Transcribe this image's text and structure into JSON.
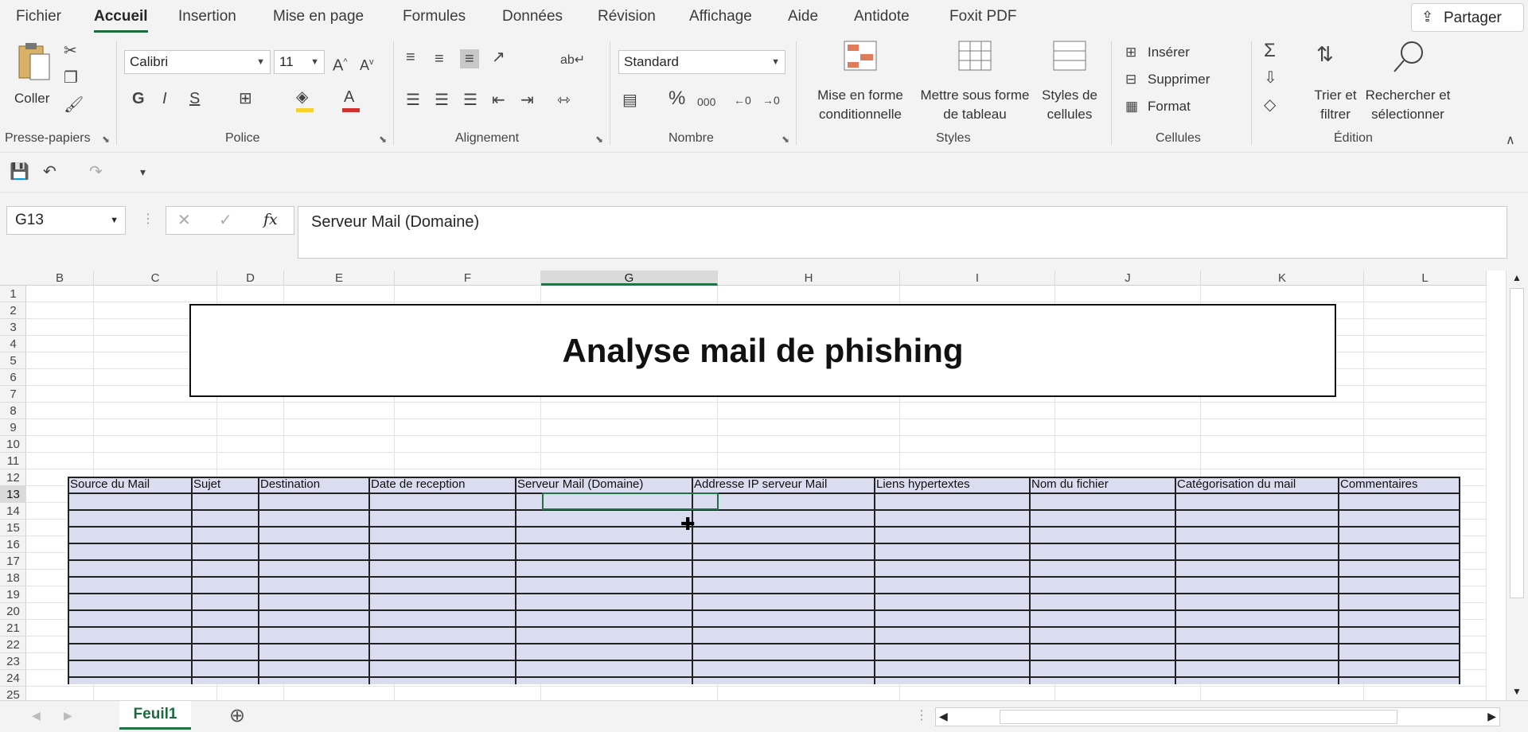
{
  "menu": {
    "tabs": [
      "Fichier",
      "Accueil",
      "Insertion",
      "Mise en page",
      "Formules",
      "Données",
      "Révision",
      "Affichage",
      "Aide",
      "Antidote",
      "Foxit PDF"
    ],
    "active": "Accueil",
    "share_label": "Partager"
  },
  "ribbon": {
    "clipboard": {
      "paste_label": "Coller",
      "group_label": "Presse-papiers"
    },
    "font": {
      "family": "Calibri",
      "size": "11",
      "bold": "G",
      "italic": "I",
      "underline": "S",
      "group_label": "Police"
    },
    "alignment": {
      "group_label": "Alignement"
    },
    "number": {
      "format": "Standard",
      "percent": "%",
      "thousands": "000",
      "group_label": "Nombre"
    },
    "styles": {
      "conditional_l1": "Mise en forme",
      "conditional_l2": "conditionnelle",
      "table_l1": "Mettre sous forme",
      "table_l2": "de tableau",
      "cellstyles_l1": "Styles de",
      "cellstyles_l2": "cellules",
      "group_label": "Styles"
    },
    "cells": {
      "insert": "Insérer",
      "delete": "Supprimer",
      "format": "Format",
      "group_label": "Cellules"
    },
    "editing": {
      "sort_l1": "Trier et",
      "sort_l2": "filtrer",
      "find_l1": "Rechercher et",
      "find_l2": "sélectionner",
      "group_label": "Édition"
    }
  },
  "formula_bar": {
    "name_box": "G13",
    "fx": "fx",
    "formula": "Serveur Mail (Domaine)"
  },
  "columns": [
    "B",
    "C",
    "D",
    "E",
    "F",
    "G",
    "H",
    "I",
    "J",
    "K",
    "L"
  ],
  "selected_column": "G",
  "rows": [
    "1",
    "2",
    "3",
    "4",
    "5",
    "6",
    "7",
    "8",
    "9",
    "10",
    "11",
    "12",
    "13",
    "14",
    "15",
    "16",
    "17",
    "18",
    "19",
    "20",
    "21",
    "22",
    "23",
    "24",
    "25"
  ],
  "selected_row": "13",
  "title": "Analyse mail de phishing",
  "table_headers": [
    "Source du Mail",
    "Sujet",
    "Destination",
    "Date de reception",
    "Serveur Mail (Domaine)",
    "Addresse IP serveur Mail",
    "Liens hypertextes",
    "Nom du fichier",
    "Catégorisation du mail",
    "Commentaires"
  ],
  "sheet_tab": "Feuil1",
  "colors": {
    "accent": "#217346",
    "table_fill": "#dadcf0"
  }
}
